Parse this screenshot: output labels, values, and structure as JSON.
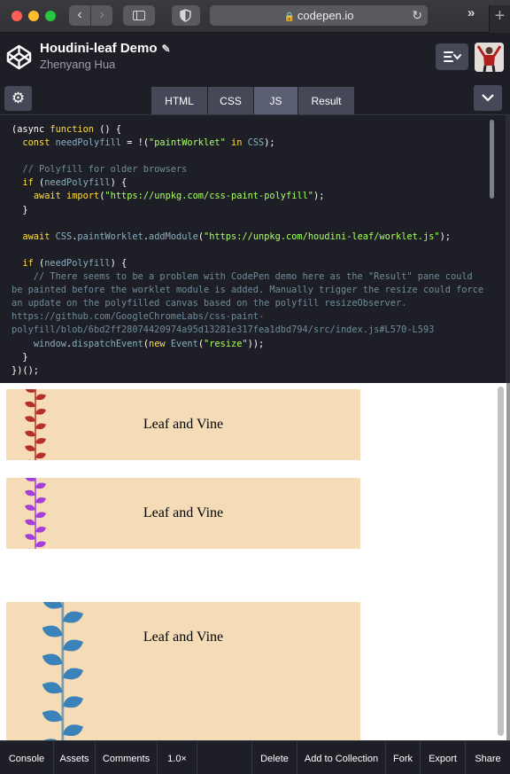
{
  "browser": {
    "url": "codepen.io"
  },
  "pen": {
    "title": "Houdini-leaf Demo",
    "author": "Zhenyang Hua"
  },
  "tabs": [
    "HTML",
    "CSS",
    "JS",
    "Result"
  ],
  "active_tab": "JS",
  "code_lines": [
    [
      [
        "p",
        "(async "
      ],
      [
        "kw",
        "function"
      ],
      [
        "p",
        " () {"
      ]
    ],
    [
      [
        "p",
        "  "
      ],
      [
        "kw",
        "const"
      ],
      [
        "p",
        " "
      ],
      [
        "id",
        "needPolyfill"
      ],
      [
        "p",
        " = !("
      ],
      [
        "str",
        "\"paintWorklet\""
      ],
      [
        "p",
        " "
      ],
      [
        "kw",
        "in"
      ],
      [
        "p",
        " "
      ],
      [
        "id",
        "CSS"
      ],
      [
        "p",
        ");"
      ]
    ],
    [
      [
        "p",
        ""
      ]
    ],
    [
      [
        "cm",
        "  // Polyfill for older browsers"
      ]
    ],
    [
      [
        "p",
        "  "
      ],
      [
        "kw",
        "if"
      ],
      [
        "p",
        " ("
      ],
      [
        "id",
        "needPolyfill"
      ],
      [
        "p",
        ") {"
      ]
    ],
    [
      [
        "p",
        "    "
      ],
      [
        "kw",
        "await"
      ],
      [
        "p",
        " "
      ],
      [
        "kw",
        "import"
      ],
      [
        "p",
        "("
      ],
      [
        "str",
        "\"https://unpkg.com/css-paint-polyfill\""
      ],
      [
        "p",
        ");"
      ]
    ],
    [
      [
        "p",
        "  }"
      ]
    ],
    [
      [
        "p",
        ""
      ]
    ],
    [
      [
        "p",
        "  "
      ],
      [
        "kw",
        "await"
      ],
      [
        "p",
        " "
      ],
      [
        "id",
        "CSS"
      ],
      [
        "p",
        "."
      ],
      [
        "id",
        "paintWorklet"
      ],
      [
        "p",
        "."
      ],
      [
        "id",
        "addModule"
      ],
      [
        "p",
        "("
      ],
      [
        "str",
        "\"https://unpkg.com/houdini-leaf/worklet.js\""
      ],
      [
        "p",
        ");"
      ]
    ],
    [
      [
        "p",
        ""
      ]
    ],
    [
      [
        "p",
        "  "
      ],
      [
        "kw",
        "if"
      ],
      [
        "p",
        " ("
      ],
      [
        "id",
        "needPolyfill"
      ],
      [
        "p",
        ") {"
      ]
    ],
    [
      [
        "cm",
        "    // There seems to be a problem with CodePen demo here as the \"Result\" pane could"
      ]
    ],
    [
      [
        "cm",
        "be painted before the worklet module is added. Manually trigger the resize could force"
      ]
    ],
    [
      [
        "cm",
        "an update on the polyfilled canvas based on the polyfill resizeObserver."
      ]
    ],
    [
      [
        "cm",
        "https://github.com/GoogleChromeLabs/css-paint-"
      ]
    ],
    [
      [
        "cm",
        "polyfill/blob/6bd2ff28074420974a95d13281e317fea1dbd794/src/index.js#L570-L593"
      ]
    ],
    [
      [
        "p",
        "    "
      ],
      [
        "id",
        "window"
      ],
      [
        "p",
        "."
      ],
      [
        "id",
        "dispatchEvent"
      ],
      [
        "p",
        "("
      ],
      [
        "kw",
        "new"
      ],
      [
        "p",
        " "
      ],
      [
        "id",
        "Event"
      ],
      [
        "p",
        "("
      ],
      [
        "str",
        "\"resize\""
      ],
      [
        "p",
        "));"
      ]
    ],
    [
      [
        "p",
        "  }"
      ]
    ],
    [
      [
        "p",
        "})();"
      ]
    ]
  ],
  "demos": [
    {
      "label": "Leaf and Vine",
      "leaf_color": "#b5302a",
      "vine_color": "#b5302a"
    },
    {
      "label": "Leaf and Vine",
      "leaf_color": "#a33ed8",
      "vine_color": "#a33ed8"
    },
    {
      "label": "Leaf and Vine",
      "leaf_color": "#3b82b8",
      "vine_color": "#7aa0b8"
    }
  ],
  "footer": {
    "console": "Console",
    "assets": "Assets",
    "comments": "Comments",
    "zoom": "1.0×",
    "delete": "Delete",
    "add_to_collection": "Add to Collection",
    "fork": "Fork",
    "export": "Export",
    "share": "Share"
  },
  "colors": {
    "background": "#1e1f26",
    "tab": "#444857",
    "active_tab": "#5a5f73",
    "demo_bg": "#f5dcb7"
  }
}
